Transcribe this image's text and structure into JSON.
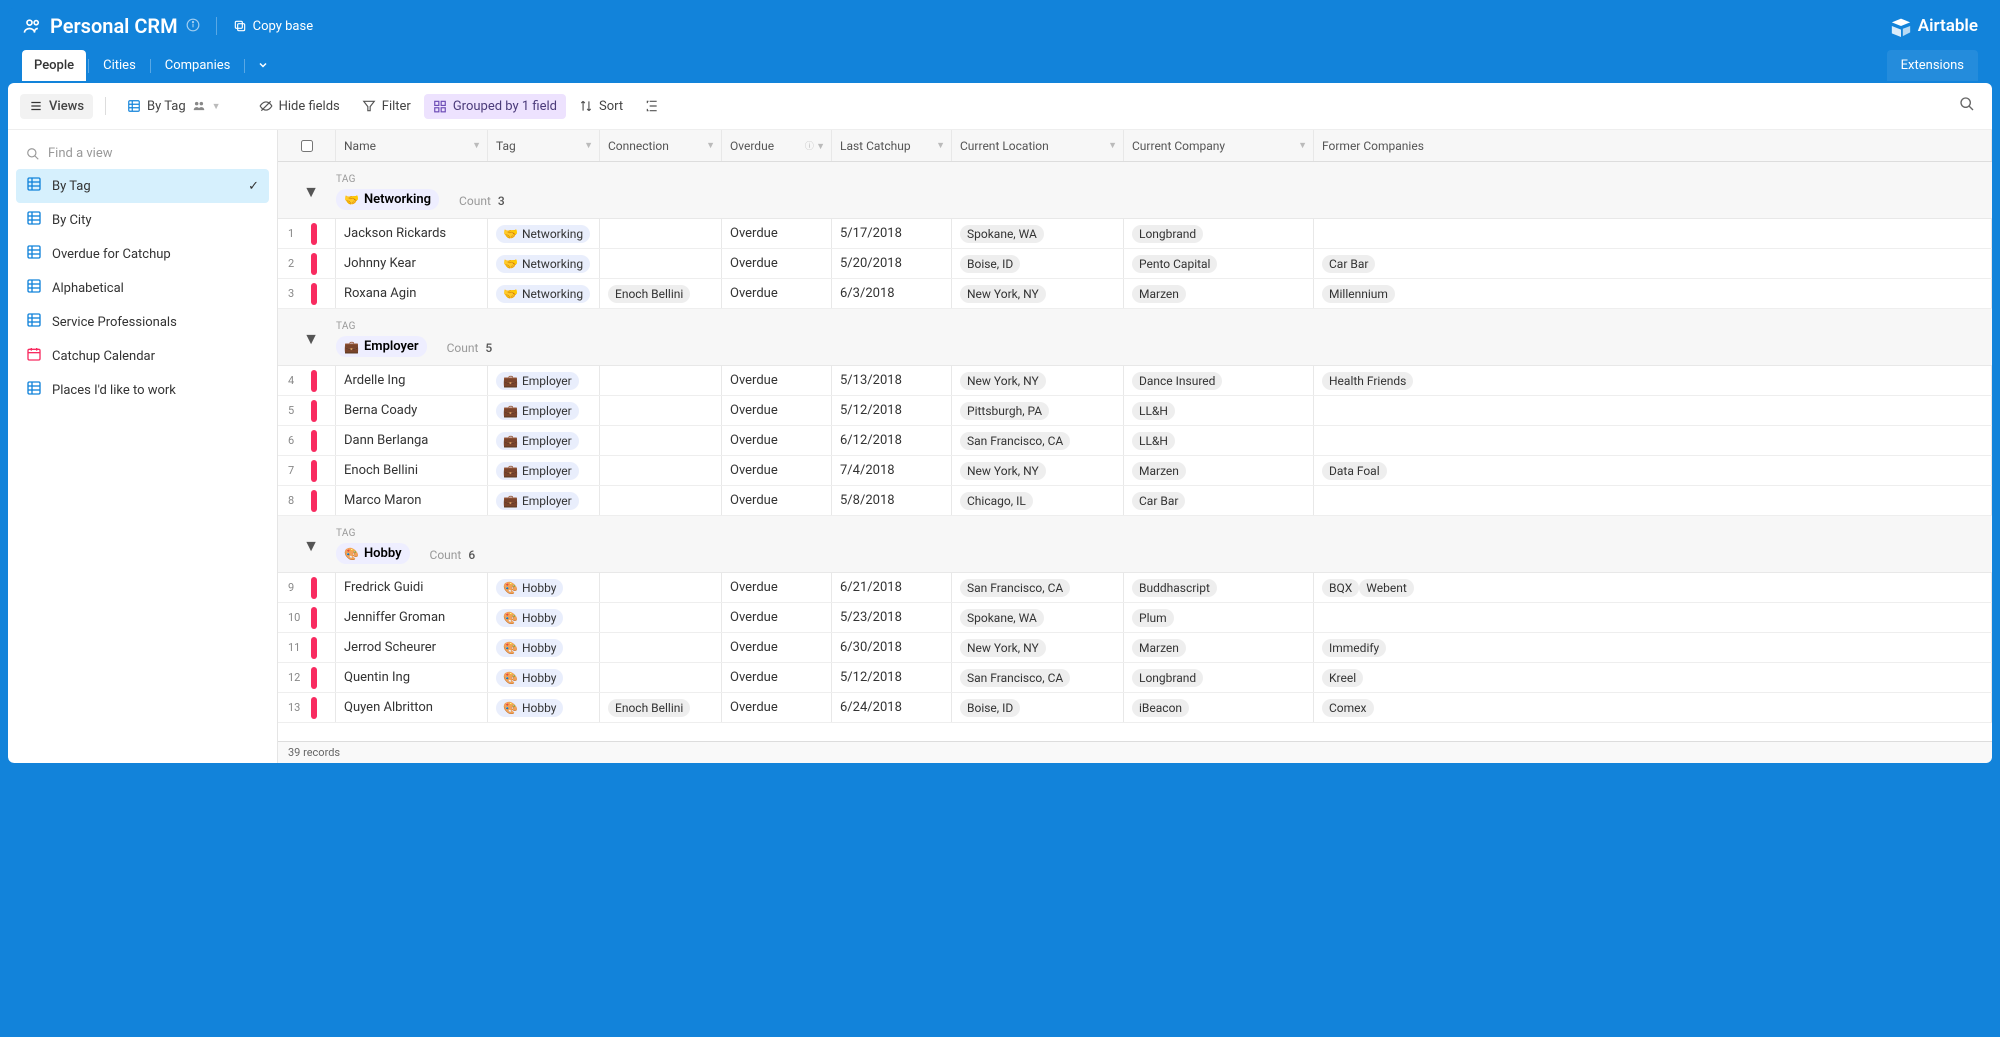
{
  "header": {
    "title": "Personal CRM",
    "copy": "Copy base",
    "brand": "Airtable"
  },
  "tabs": [
    "People",
    "Cities",
    "Companies"
  ],
  "activeTab": 0,
  "extensions": "Extensions",
  "toolbar": {
    "views": "Views",
    "byTag": "By Tag",
    "hideFields": "Hide fields",
    "filter": "Filter",
    "grouped": "Grouped by 1 field",
    "sort": "Sort"
  },
  "sidebar": {
    "findPlaceholder": "Find a view",
    "views": [
      {
        "label": "By Tag",
        "type": "grid",
        "active": true
      },
      {
        "label": "By City",
        "type": "grid"
      },
      {
        "label": "Overdue for Catchup",
        "type": "grid"
      },
      {
        "label": "Alphabetical",
        "type": "grid"
      },
      {
        "label": "Service Professionals",
        "type": "grid"
      },
      {
        "label": "Catchup Calendar",
        "type": "cal"
      },
      {
        "label": "Places I'd like to work",
        "type": "grid"
      }
    ]
  },
  "columns": [
    "Name",
    "Tag",
    "Connection",
    "Overdue",
    "Last Catchup",
    "Current Location",
    "Current Company",
    "Former Companies"
  ],
  "groups": [
    {
      "tag": "Networking",
      "emoji": "🤝",
      "count": 3,
      "rows": [
        {
          "n": 1,
          "name": "Jackson Rickards",
          "conn": "",
          "overdue": "Overdue",
          "date": "5/17/2018",
          "loc": "Spokane, WA",
          "comp": "Longbrand",
          "former": []
        },
        {
          "n": 2,
          "name": "Johnny Kear",
          "conn": "",
          "overdue": "Overdue",
          "date": "5/20/2018",
          "loc": "Boise, ID",
          "comp": "Pento Capital",
          "former": [
            "Car Bar"
          ]
        },
        {
          "n": 3,
          "name": "Roxana Agin",
          "conn": "Enoch Bellini",
          "overdue": "Overdue",
          "date": "6/3/2018",
          "loc": "New York, NY",
          "comp": "Marzen",
          "former": [
            "Millennium"
          ]
        }
      ]
    },
    {
      "tag": "Employer",
      "emoji": "💼",
      "count": 5,
      "rows": [
        {
          "n": 4,
          "name": "Ardelle Ing",
          "conn": "",
          "overdue": "Overdue",
          "date": "5/13/2018",
          "loc": "New York, NY",
          "comp": "Dance Insured",
          "former": [
            "Health Friends"
          ]
        },
        {
          "n": 5,
          "name": "Berna Coady",
          "conn": "",
          "overdue": "Overdue",
          "date": "5/12/2018",
          "loc": "Pittsburgh, PA",
          "comp": "LL&H",
          "former": []
        },
        {
          "n": 6,
          "name": "Dann Berlanga",
          "conn": "",
          "overdue": "Overdue",
          "date": "6/12/2018",
          "loc": "San Francisco, CA",
          "comp": "LL&H",
          "former": []
        },
        {
          "n": 7,
          "name": "Enoch Bellini",
          "conn": "",
          "overdue": "Overdue",
          "date": "7/4/2018",
          "loc": "New York, NY",
          "comp": "Marzen",
          "former": [
            "Data Foal"
          ]
        },
        {
          "n": 8,
          "name": "Marco Maron",
          "conn": "",
          "overdue": "Overdue",
          "date": "5/8/2018",
          "loc": "Chicago, IL",
          "comp": "Car Bar",
          "former": []
        }
      ]
    },
    {
      "tag": "Hobby",
      "emoji": "🎨",
      "count": 6,
      "rows": [
        {
          "n": 9,
          "name": "Fredrick Guidi",
          "conn": "",
          "overdue": "Overdue",
          "date": "6/21/2018",
          "loc": "San Francisco, CA",
          "comp": "Buddhascript",
          "former": [
            "BQX",
            "Webent"
          ]
        },
        {
          "n": 10,
          "name": "Jenniffer Groman",
          "conn": "",
          "overdue": "Overdue",
          "date": "5/23/2018",
          "loc": "Spokane, WA",
          "comp": "Plum",
          "former": []
        },
        {
          "n": 11,
          "name": "Jerrod Scheurer",
          "conn": "",
          "overdue": "Overdue",
          "date": "6/30/2018",
          "loc": "New York, NY",
          "comp": "Marzen",
          "former": [
            "Immedify"
          ]
        },
        {
          "n": 12,
          "name": "Quentin Ing",
          "conn": "",
          "overdue": "Overdue",
          "date": "5/12/2018",
          "loc": "San Francisco, CA",
          "comp": "Longbrand",
          "former": [
            "Kreel"
          ]
        },
        {
          "n": 13,
          "name": "Quyen Albritton",
          "conn": "Enoch Bellini",
          "overdue": "Overdue",
          "date": "6/24/2018",
          "loc": "Boise, ID",
          "comp": "iBeacon",
          "former": [
            "Comex"
          ]
        }
      ]
    }
  ],
  "footer": {
    "records": "39 records"
  },
  "labels": {
    "tag": "TAG",
    "count": "Count"
  }
}
